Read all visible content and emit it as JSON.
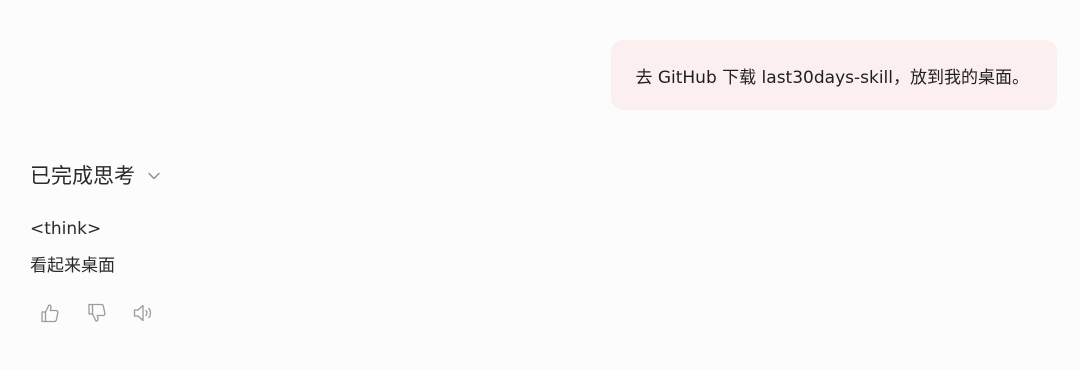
{
  "user_message": {
    "text": "去 GitHub 下载 last30days-skill，放到我的桌面。"
  },
  "assistant": {
    "thinking_header": "已完成思考",
    "thinking_lines": [
      "<think>",
      "看起来桌面"
    ],
    "actions": {
      "like_icon": "thumbs-up-icon",
      "dislike_icon": "thumbs-down-icon",
      "speaker_icon": "speaker-icon"
    }
  },
  "colors": {
    "user_bubble_bg": "#fcefef",
    "page_bg": "#fdfcfc",
    "icon_gray": "#9a9a9a"
  }
}
